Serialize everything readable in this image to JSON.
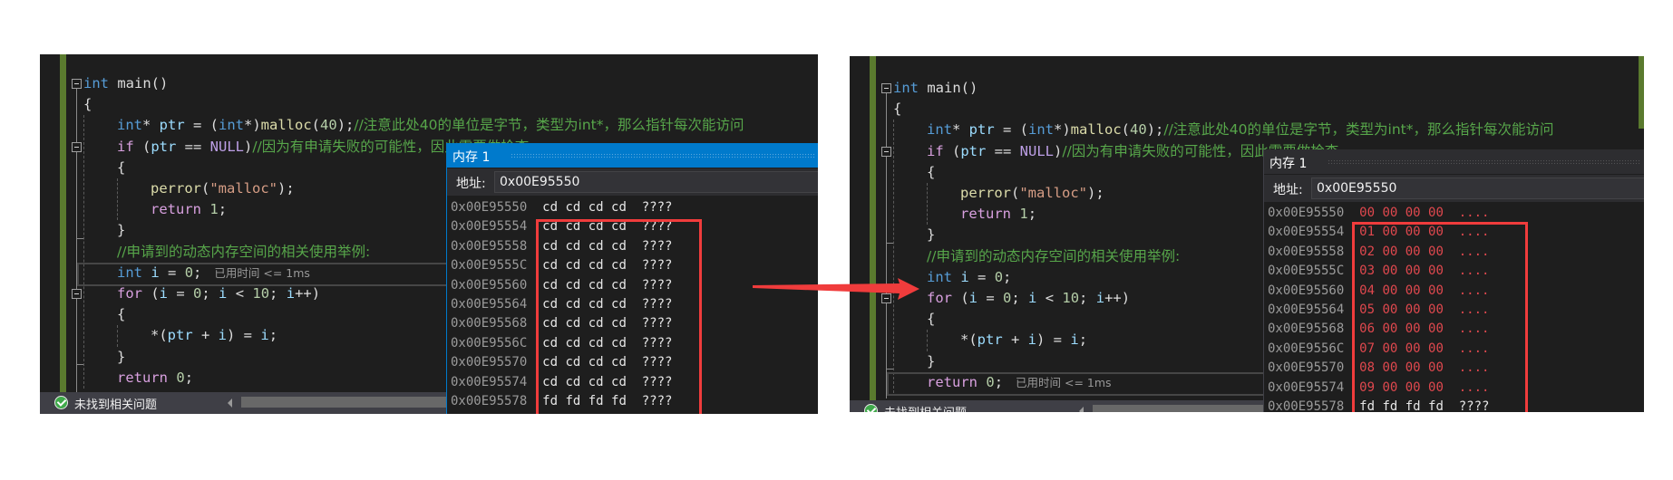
{
  "code": {
    "lines": [
      {
        "parts": [
          [
            "kw",
            "int"
          ],
          [
            "p",
            " main()"
          ]
        ]
      },
      {
        "parts": [
          [
            "p",
            "{"
          ]
        ]
      },
      {
        "parts": [
          [
            "kw",
            "int"
          ],
          [
            "p",
            "* "
          ],
          [
            "var",
            "ptr"
          ],
          [
            "p",
            " = ("
          ],
          [
            "kw",
            "int"
          ],
          [
            "p",
            "*)"
          ],
          [
            "fn",
            "malloc"
          ],
          [
            "p",
            "("
          ],
          [
            "num",
            "40"
          ],
          [
            "p",
            ");"
          ],
          [
            "cmt",
            "//注意此处40的单位是字节，类型为int*，那么指针每次能访问"
          ]
        ]
      },
      {
        "parts": [
          [
            "ctl",
            "if"
          ],
          [
            "p",
            " ("
          ],
          [
            "var",
            "ptr"
          ],
          [
            "p",
            " == "
          ],
          [
            "macro",
            "NULL"
          ],
          [
            "p",
            ")"
          ],
          [
            "cmt",
            "//因为有申请失败的可能性，因此需要做检查"
          ]
        ]
      },
      {
        "parts": [
          [
            "p",
            "{"
          ]
        ]
      },
      {
        "parts": [
          [
            "fn",
            "perror"
          ],
          [
            "p",
            "("
          ],
          [
            "str",
            "\"malloc\""
          ],
          [
            "p",
            ");"
          ]
        ]
      },
      {
        "parts": [
          [
            "ctl",
            "return"
          ],
          [
            "p",
            " "
          ],
          [
            "num",
            "1"
          ],
          [
            "p",
            ";"
          ]
        ]
      },
      {
        "parts": [
          [
            "p",
            "}"
          ]
        ]
      },
      {
        "parts": [
          [
            "cmt",
            "//申请到的动态内存空间的相关使用举例:"
          ]
        ]
      },
      {
        "parts": [
          [
            "kw",
            "int"
          ],
          [
            "p",
            " "
          ],
          [
            "var",
            "i"
          ],
          [
            "p",
            " = "
          ],
          [
            "num",
            "0"
          ],
          [
            "p",
            ";"
          ]
        ]
      },
      {
        "parts": [
          [
            "ctl",
            "for"
          ],
          [
            "p",
            " ("
          ],
          [
            "var",
            "i"
          ],
          [
            "p",
            " = "
          ],
          [
            "num",
            "0"
          ],
          [
            "p",
            "; "
          ],
          [
            "var",
            "i"
          ],
          [
            "p",
            " < "
          ],
          [
            "num",
            "10"
          ],
          [
            "p",
            "; "
          ],
          [
            "var",
            "i"
          ],
          [
            "p",
            "++)"
          ]
        ]
      },
      {
        "parts": [
          [
            "p",
            "{"
          ]
        ]
      },
      {
        "parts": [
          [
            "p",
            "*("
          ],
          [
            "var",
            "ptr"
          ],
          [
            "p",
            " + "
          ],
          [
            "var",
            "i"
          ],
          [
            "p",
            ") = "
          ],
          [
            "var",
            "i"
          ],
          [
            "p",
            ";"
          ]
        ]
      },
      {
        "parts": [
          [
            "p",
            "}"
          ]
        ]
      },
      {
        "parts": [
          [
            "ctl",
            "return"
          ],
          [
            "p",
            " "
          ],
          [
            "num",
            "0"
          ],
          [
            "p",
            ";"
          ]
        ]
      }
    ],
    "indents": [
      0,
      1,
      2,
      2,
      2,
      3,
      3,
      2,
      2,
      2,
      2,
      2,
      3,
      2,
      2
    ]
  },
  "elapsed_hint": "已用时间 <= 1ms",
  "status_text": "未找到相关问题",
  "memory_window": {
    "title": "内存 1",
    "address_label": "地址:",
    "address_value": "0x00E95550"
  },
  "before": {
    "current_line_index": 9,
    "rows": [
      {
        "addr": "0x00E95550",
        "bytes": "cd cd cd cd",
        "chars": "????",
        "changed": false
      },
      {
        "addr": "0x00E95554",
        "bytes": "cd cd cd cd",
        "chars": "????",
        "changed": false
      },
      {
        "addr": "0x00E95558",
        "bytes": "cd cd cd cd",
        "chars": "????",
        "changed": false
      },
      {
        "addr": "0x00E9555C",
        "bytes": "cd cd cd cd",
        "chars": "????",
        "changed": false
      },
      {
        "addr": "0x00E95560",
        "bytes": "cd cd cd cd",
        "chars": "????",
        "changed": false
      },
      {
        "addr": "0x00E95564",
        "bytes": "cd cd cd cd",
        "chars": "????",
        "changed": false
      },
      {
        "addr": "0x00E95568",
        "bytes": "cd cd cd cd",
        "chars": "????",
        "changed": false
      },
      {
        "addr": "0x00E9556C",
        "bytes": "cd cd cd cd",
        "chars": "????",
        "changed": false
      },
      {
        "addr": "0x00E95570",
        "bytes": "cd cd cd cd",
        "chars": "????",
        "changed": false
      },
      {
        "addr": "0x00E95574",
        "bytes": "cd cd cd cd",
        "chars": "????",
        "changed": false
      },
      {
        "addr": "0x00E95578",
        "bytes": "fd fd fd fd",
        "chars": "????",
        "changed": false
      }
    ]
  },
  "after": {
    "current_line_index": 14,
    "rows": [
      {
        "addr": "0x00E95550",
        "bytes": "00 00 00 00",
        "chars": "....",
        "changed": true
      },
      {
        "addr": "0x00E95554",
        "bytes": "01 00 00 00",
        "chars": "....",
        "changed": true
      },
      {
        "addr": "0x00E95558",
        "bytes": "02 00 00 00",
        "chars": "....",
        "changed": true
      },
      {
        "addr": "0x00E9555C",
        "bytes": "03 00 00 00",
        "chars": "....",
        "changed": true
      },
      {
        "addr": "0x00E95560",
        "bytes": "04 00 00 00",
        "chars": "....",
        "changed": true
      },
      {
        "addr": "0x00E95564",
        "bytes": "05 00 00 00",
        "chars": "....",
        "changed": true
      },
      {
        "addr": "0x00E95568",
        "bytes": "06 00 00 00",
        "chars": "....",
        "changed": true
      },
      {
        "addr": "0x00E9556C",
        "bytes": "07 00 00 00",
        "chars": "....",
        "changed": true
      },
      {
        "addr": "0x00E95570",
        "bytes": "08 00 00 00",
        "chars": "....",
        "changed": true
      },
      {
        "addr": "0x00E95574",
        "bytes": "09 00 00 00",
        "chars": "....",
        "changed": true
      },
      {
        "addr": "0x00E95578",
        "bytes": "fd fd fd fd",
        "chars": "????",
        "changed": false
      }
    ]
  },
  "colors": {
    "annotation_red": "#f03c3c",
    "active_title_blue": "#007acc",
    "inactive_title_gray": "#2d2d30",
    "changed_byte_red": "#e0484e"
  }
}
